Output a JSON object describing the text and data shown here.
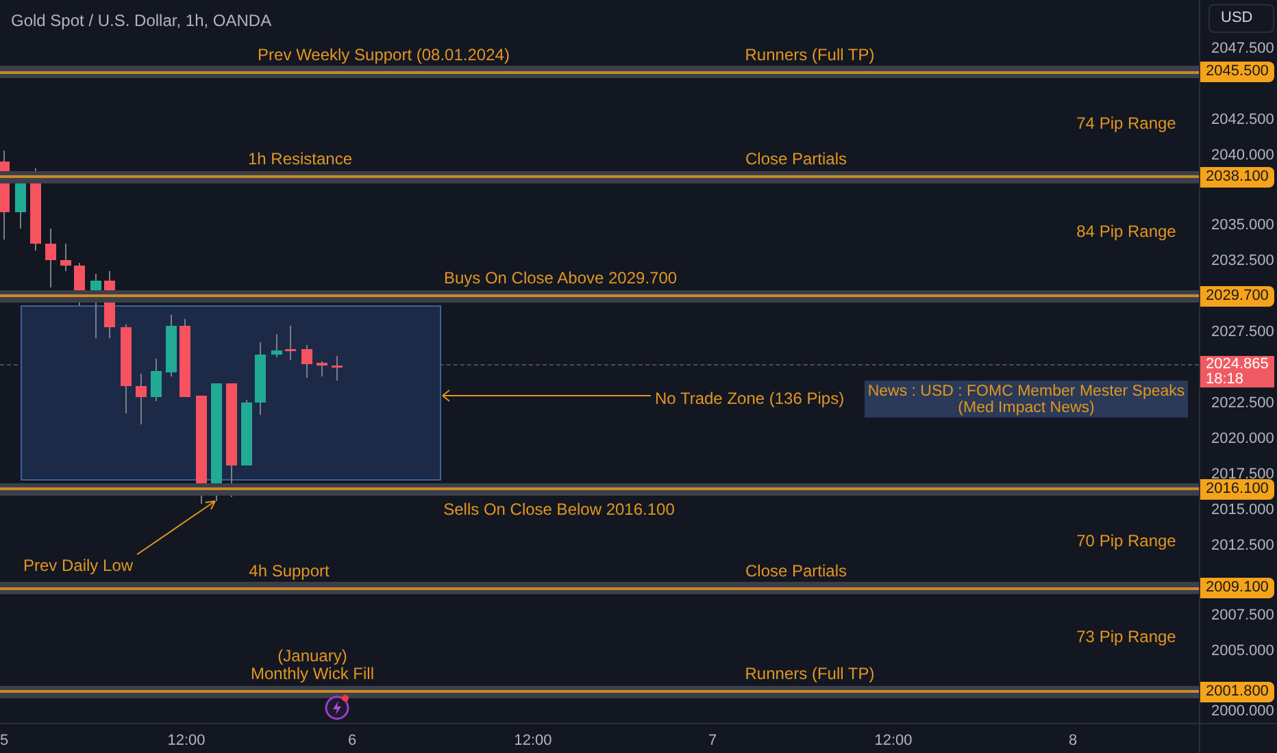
{
  "title": "Gold Spot / U.S. Dollar, 1h, OANDA",
  "currency_button": "USD",
  "price_ticks": [
    "2047.500",
    "2042.500",
    "2040.000",
    "2035.000",
    "2032.500",
    "2027.500",
    "2022.500",
    "2020.000",
    "2017.500",
    "2015.000",
    "2012.500",
    "2007.500",
    "2005.000",
    "2000.000"
  ],
  "levels": [
    {
      "price": "2045.500",
      "left_label": "Prev Weekly Support (08.01.2024)",
      "right_label": "Runners (Full TP)"
    },
    {
      "price": "2038.100",
      "left_label": "1h Resistance",
      "right_label": "Close Partials"
    },
    {
      "price": "2029.700",
      "left_label": "Buys On Close Above 2029.700"
    },
    {
      "price": "2016.100",
      "left_label": "Sells On Close Below 2016.100"
    },
    {
      "price": "2009.100",
      "left_label": "4h Support",
      "right_label": "Close Partials"
    },
    {
      "price": "2001.800",
      "left_label": "(January)\nMonthly Wick Fill",
      "right_label": "Runners (Full TP)"
    }
  ],
  "ranges": [
    "74 Pip Range",
    "84 Pip Range",
    "70 Pip Range",
    "73 Pip Range"
  ],
  "zone_label": "No Trade Zone (136 Pips)",
  "news": [
    "News : USD : FOMC Member Mester Speaks",
    "(Med Impact News)"
  ],
  "prev_daily_low": "Prev Daily Low",
  "current_price": {
    "price": "2024.865",
    "countdown": "18:18"
  },
  "time_ticks": [
    "5",
    "12:00",
    "6",
    "12:00",
    "7",
    "12:00",
    "8"
  ]
}
